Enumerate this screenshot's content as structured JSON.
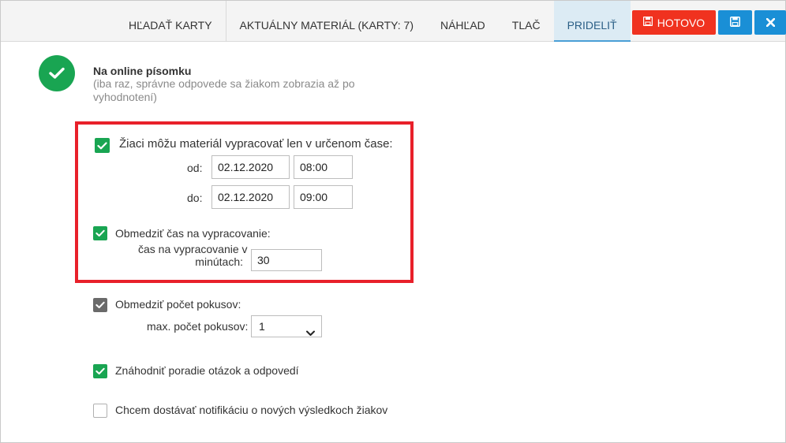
{
  "tabs": [
    {
      "label": "HĽADAŤ KARTY"
    },
    {
      "label": "AKTUÁLNY MATERIÁL (KARTY: 7)"
    },
    {
      "label": "NÁHĽAD"
    },
    {
      "label": "TLAČ"
    },
    {
      "label": "PRIDELIŤ"
    }
  ],
  "toolbar": {
    "done_label": "HOTOVO",
    "save_icon": "save-icon",
    "close_icon": "close-icon"
  },
  "header": {
    "title": "Na online písomku",
    "subtitle": "(iba raz, správne odpovede sa žiakom zobrazia až po vyhodnotení)"
  },
  "schedule": {
    "label": "Žiaci môžu materiál vypracovať len v určenom čase:",
    "checked": true,
    "from_label": "od:",
    "from_date": "02.12.2020",
    "from_time": "08:00",
    "to_label": "do:",
    "to_date": "02.12.2020",
    "to_time": "09:00"
  },
  "time_limit": {
    "label": "Obmedziť čas na vypracovanie:",
    "checked": true,
    "minutes_label": "čas na vypracovanie v minútach:",
    "minutes_line1": "čas na vypracovanie v",
    "minutes_line2": "minútach:",
    "minutes": "30"
  },
  "attempts": {
    "label": "Obmedziť počet pokusov:",
    "checked": true,
    "max_label": "max. počet pokusov:",
    "max_value": "1"
  },
  "shuffle": {
    "label": "Znáhodniť poradie otázok a odpovedí",
    "checked": true
  },
  "notify": {
    "label": "Chcem dostávať notifikáciu o nových výsledkoch žiakov",
    "checked": false
  },
  "colors": {
    "accent_green": "#19a552",
    "danger_red": "#f0321f",
    "primary_blue": "#1a8fd6",
    "highlight_red": "#e8202a"
  }
}
